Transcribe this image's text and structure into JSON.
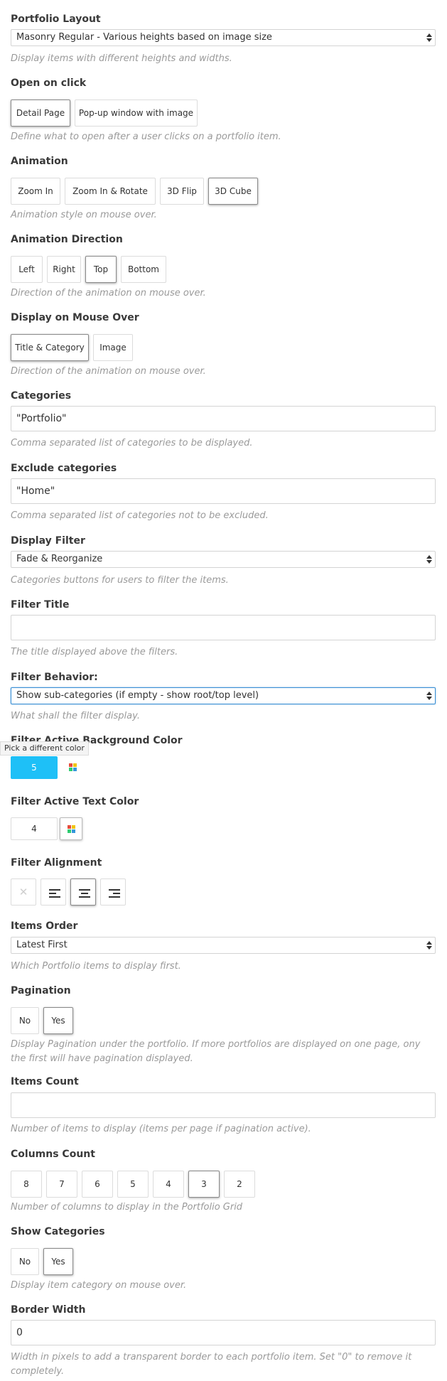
{
  "portfolio_layout": {
    "label": "Portfolio Layout",
    "value": "Masonry Regular - Various heights based on image size",
    "description": "Display items with different heights and widths."
  },
  "open_on_click": {
    "label": "Open on click",
    "options": [
      "Detail Page",
      "Pop-up window with image"
    ],
    "selected": 0,
    "description": "Define what to open after a user clicks on a portfolio item."
  },
  "animation": {
    "label": "Animation",
    "options": [
      "Zoom In",
      "Zoom In & Rotate",
      "3D Flip",
      "3D Cube"
    ],
    "selected": 3,
    "description": "Animation style on mouse over."
  },
  "animation_direction": {
    "label": "Animation Direction",
    "options": [
      "Left",
      "Right",
      "Top",
      "Bottom"
    ],
    "selected": 2,
    "description": "Direction of the animation on mouse over."
  },
  "display_on_mouse_over": {
    "label": "Display on Mouse Over",
    "options": [
      "Title & Category",
      "Image"
    ],
    "selected": 0,
    "description": "Direction of the animation on mouse over."
  },
  "categories": {
    "label": "Categories",
    "value": "\"Portfolio\"",
    "description": "Comma separated list of categories to be displayed."
  },
  "exclude_categories": {
    "label": "Exclude categories",
    "value": "\"Home\"",
    "description": "Comma separated list of categories not to be excluded."
  },
  "display_filter": {
    "label": "Display Filter",
    "value": "Fade & Reorganize",
    "description": "Categories buttons for users to filter the items."
  },
  "filter_title": {
    "label": "Filter Title",
    "value": "",
    "description": "The title displayed above the filters."
  },
  "filter_behavior": {
    "label": "Filter Behavior:",
    "value": "Show sub-categories (if empty - show root/top level)",
    "description": "What shall the filter display."
  },
  "filter_active_bg_color": {
    "label": "Filter Active Background Color",
    "value": "5",
    "swatch_color": "#1ec0f7",
    "tooltip": "Pick a different color"
  },
  "filter_active_text_color": {
    "label": "Filter Active Text Color",
    "value": "4",
    "swatch_color": "#ffffff"
  },
  "filter_alignment": {
    "label": "Filter Alignment",
    "options": [
      "none-icon",
      "align-left-icon",
      "align-center-icon",
      "align-right-icon"
    ],
    "selected": 2
  },
  "items_order": {
    "label": "Items Order",
    "value": "Latest First",
    "description": "Which Portfolio items to display first."
  },
  "pagination": {
    "label": "Pagination",
    "options": [
      "No",
      "Yes"
    ],
    "selected": 1,
    "description": "Display Pagination under the portfolio. If more portfolios are displayed on one page, ony the first will have pagination displayed."
  },
  "items_count": {
    "label": "Items Count",
    "value": "",
    "description": "Number of items to display (items per page if pagination active)."
  },
  "columns_count": {
    "label": "Columns Count",
    "options": [
      "8",
      "7",
      "6",
      "5",
      "4",
      "3",
      "2"
    ],
    "selected": 5,
    "description": "Number of columns to display in the Portfolio Grid"
  },
  "show_categories": {
    "label": "Show Categories",
    "options": [
      "No",
      "Yes"
    ],
    "selected": 1,
    "description": "Display item category on mouse over."
  },
  "border_width": {
    "label": "Border Width",
    "value": "0",
    "description": "Width in pixels to add a transparent border to each portfolio item. Set \"0\" to remove it completely."
  },
  "colors": {
    "focus_blue": "#3a8fd4",
    "description_gray": "#9a9a9a",
    "label_dark": "#3a3a3a"
  }
}
